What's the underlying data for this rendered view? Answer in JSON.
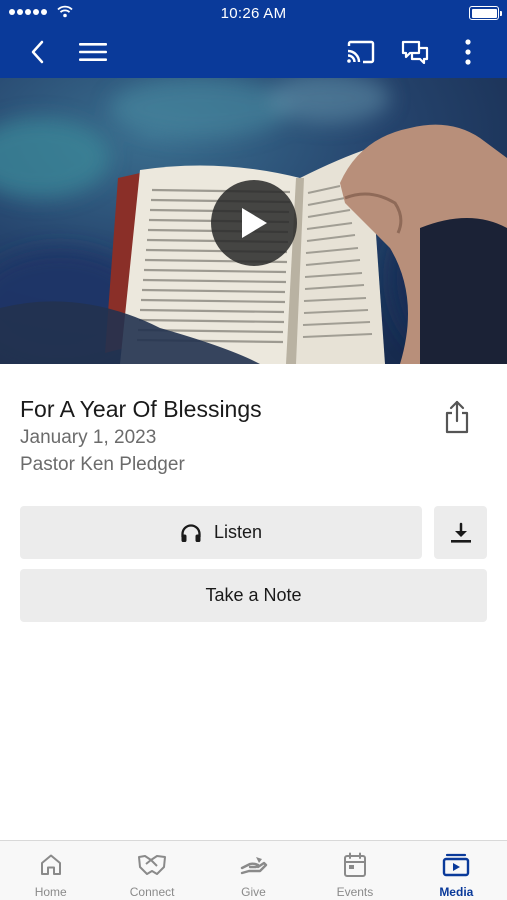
{
  "status_bar": {
    "time": "10:26 AM"
  },
  "app_bar": {
    "icons": [
      "back-icon",
      "menu-icon",
      "cast-icon",
      "chat-icon",
      "more-icon"
    ]
  },
  "media": {
    "title": "For A Year Of Blessings",
    "date": "January 1, 2023",
    "speaker": "Pastor Ken Pledger"
  },
  "actions": {
    "listen_label": "Listen",
    "note_label": "Take a Note"
  },
  "tabs": [
    {
      "label": "Home",
      "icon": "home-icon",
      "active": false
    },
    {
      "label": "Connect",
      "icon": "connect-icon",
      "active": false
    },
    {
      "label": "Give",
      "icon": "give-icon",
      "active": false
    },
    {
      "label": "Events",
      "icon": "calendar-icon",
      "active": false
    },
    {
      "label": "Media",
      "icon": "media-icon",
      "active": true
    }
  ],
  "colors": {
    "brand": "#0a3a9a",
    "secondary_text": "#6b6b6b",
    "button_bg": "#ececec",
    "inactive_tab": "#8a8a8a"
  }
}
